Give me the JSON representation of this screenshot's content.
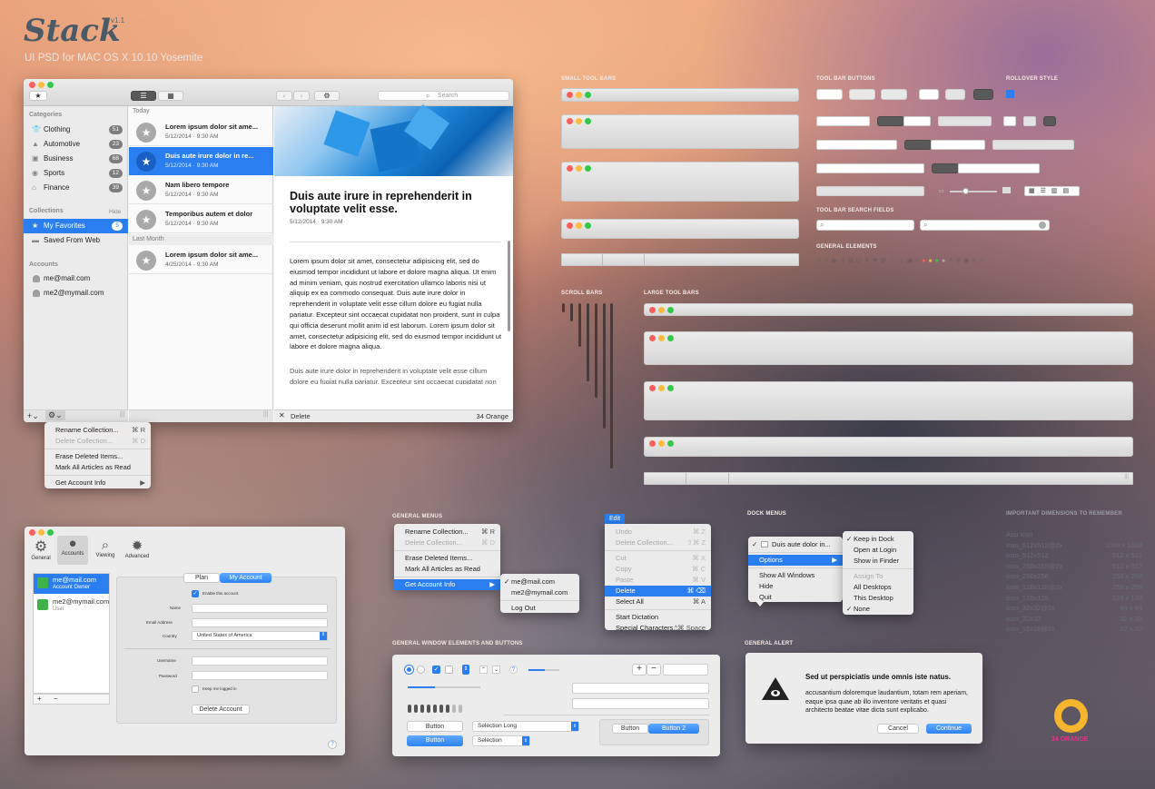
{
  "brand": {
    "logo": "Stack",
    "version": "v1.1",
    "subtitle": "UI PSD for MAC OS X 10.10 Yosemite"
  },
  "labels": {
    "small_tool_bars": "SMALL TOOL BARS",
    "tool_bar_buttons": "TOOL BAR BUTTONS",
    "rollover_style": "ROLLOVER STYLE",
    "tool_bar_search_fields": "TOOL BAR SEARCH FIELDS",
    "general_elements": "GENERAL ELEMENTS",
    "scroll_bars": "SCROLL BARS",
    "large_tool_bars": "LARGE TOOL BARS",
    "general_menus": "GENERAL MENUS",
    "dock_menus": "DOCK MENUS",
    "important_dimensions": "IMPORTANT DIMENSIONS TO REMEMBER",
    "general_window_elements": "GENERAL WINDOW ELEMENTS AND BUTTONS",
    "general_alert": "GENERAL ALERT"
  },
  "mail": {
    "search_placeholder": "Search",
    "categories_header": "Categories",
    "categories": [
      {
        "label": "Clothing",
        "count": "51"
      },
      {
        "label": "Automotive",
        "count": "23"
      },
      {
        "label": "Business",
        "count": "68"
      },
      {
        "label": "Sports",
        "count": "12"
      },
      {
        "label": "Finance",
        "count": "39"
      }
    ],
    "collections_header": "Collections",
    "hide": "Hide",
    "collections": [
      {
        "label": "My Favorites",
        "count": "5"
      },
      {
        "label": "Saved From Web"
      }
    ],
    "accounts_header": "Accounts",
    "accounts": [
      "me@mail.com",
      "me2@mymail.com"
    ],
    "today": "Today",
    "last_month": "Last Month",
    "messages": [
      {
        "title": "Lorem ipsum dolor sit ame...",
        "date": "5/12/2014  ·  9:30 AM"
      },
      {
        "title": "Duis aute irure dolor in re...",
        "date": "5/12/2014  ·  9:30 AM"
      },
      {
        "title": "Nam libero tempore",
        "date": "5/12/2014  ·  9:30 AM"
      },
      {
        "title": "Temporibus autem et dolor",
        "date": "5/12/2014  ·  9:30 AM"
      },
      {
        "title": "Lorem ipsum dolor sit ame...",
        "date": "4/25/2014  ·  9:30 AM"
      }
    ],
    "article_title": "Duis aute irure in reprehenderit in voluptate velit esse.",
    "article_date": "5/12/2014  ·  9:30 AM",
    "article_body": "Lorem ipsum dolor sit amet, consectetur adipisicing elit, sed do eiusmod tempor incididunt ut labore et dolore magna aliqua. Ut enim ad minim veniam, quis nostrud exercitation ullamco laboris nisi ut aliquip ex ea commodo consequat. Duis aute irure dolor in reprehenderit in voluptate velit esse cillum dolore eu fugiat nulla pariatur. Excepteur sint occaecat cupidatat non proident, sunt in culpa qui officia deserunt mollit anim id est laborum. Lorem ipsum dolor sit amet, consectetur adipisicing elit, sed do eiusmod tempor incididunt ut labore et dolore magna aliqua.",
    "article_body2": "Duis aute irure dolor in reprehenderit in voluptate velit esse cillum dolore eu fugiat nulla pariatur. Excepteur sint occaecat cupidatat non",
    "delete": "Delete",
    "footer_right": "34 Orange",
    "context_menu": [
      {
        "label": "Rename Collection...",
        "sc": "⌘ R"
      },
      {
        "label": "Delete Collection...",
        "sc": "⌘ D"
      },
      {
        "label": "Erase Deleted Items..."
      },
      {
        "label": "Mark All Articles as Read"
      },
      {
        "label": "Get Account Info",
        "sc": "▶"
      }
    ]
  },
  "prefs": {
    "tabs": [
      "General",
      "Accounts",
      "Viewing",
      "Advanced"
    ],
    "accounts": [
      {
        "name": "me@mail.com",
        "role": "Account Owner"
      },
      {
        "name": "me2@mymail.com",
        "role": "User"
      }
    ],
    "seg": [
      "Plan",
      "My Account"
    ],
    "enable": "Enable this account",
    "name": "Name",
    "email": "Email Address",
    "country": "Country",
    "country_value": "United States of America",
    "username": "Username",
    "password": "Password",
    "keep": "Keep me logged in",
    "delete_account": "Delete Account"
  },
  "general_menu": {
    "items": [
      {
        "label": "Rename Collection...",
        "sc": "⌘ R"
      },
      {
        "label": "Delete Collection...",
        "sc": "⌘ D"
      },
      {
        "label": "Erase Deleted Items..."
      },
      {
        "label": "Mark All Articles as Read"
      },
      {
        "label": "Get Account Info",
        "sc": "▶"
      }
    ],
    "submenu": [
      "me@mail.com",
      "me2@mymail.com",
      "Log Out"
    ]
  },
  "edit_menu": {
    "title": "Edit",
    "items": [
      {
        "label": "Undo",
        "sc": "⌘ Z"
      },
      {
        "label": "Delete Collection...",
        "sc": "⇧⌘ Z"
      },
      {
        "label": "Cut",
        "sc": "⌘ X"
      },
      {
        "label": "Copy",
        "sc": "⌘ C"
      },
      {
        "label": "Paste",
        "sc": "⌘ V"
      },
      {
        "label": "Delete",
        "sc": "⌘ ⌫"
      },
      {
        "label": "Select All",
        "sc": "⌘ A"
      },
      {
        "label": "Start Dictation"
      },
      {
        "label": "Special Characters...",
        "sc": "^⌘ Space"
      }
    ]
  },
  "dock_menu": {
    "item": "Duis aute dolor in...",
    "options": "Options",
    "show_all": "Show All Windows",
    "hide": "Hide",
    "quit": "Quit",
    "sub": [
      "Keep in Dock",
      "Open at Login",
      "Show in Finder"
    ],
    "assign": "Assign To",
    "assign_items": [
      "All Desktops",
      "This Desktop",
      "None"
    ]
  },
  "dimensions": {
    "app_icon": "App Icon",
    "rows": [
      {
        "k": "icon_512x512@2x",
        "v": "1024 x 1024"
      },
      {
        "k": "icon_512x512",
        "v": "512 x 512"
      },
      {
        "k": "icon_256x256@2x",
        "v": "512 x 512"
      },
      {
        "k": "icon_256x256",
        "v": "256 x 256"
      },
      {
        "k": "icon_128x128@2x",
        "v": "256 x 256"
      },
      {
        "k": "icon_128x128",
        "v": "128 x 128"
      },
      {
        "k": "icon_32x32@2x",
        "v": "64 x 64"
      },
      {
        "k": "icon_32x32",
        "v": "32 x 32"
      },
      {
        "k": "icon_16x16@2x",
        "v": "32 x 32"
      }
    ]
  },
  "window_elements": {
    "button": "Button",
    "selection_long": "Selection Long",
    "selection": "Selection",
    "button2": "Button 2"
  },
  "alert": {
    "title": "Sed ut perspiciatis unde omnis iste natus.",
    "body": "accusantium doloremque laudantium, totam rem aperiam, eaque ipsa quae ab illo inventore veritatis et quasi architecto beatae vitae dicta sunt explicabo.",
    "cancel": "Cancel",
    "continue": "Continue"
  },
  "orange_logo": "34 ORANGE",
  "colors": {
    "accent": "#2a7ef0",
    "orange": "#f5b52e",
    "pink": "#e8338c"
  }
}
